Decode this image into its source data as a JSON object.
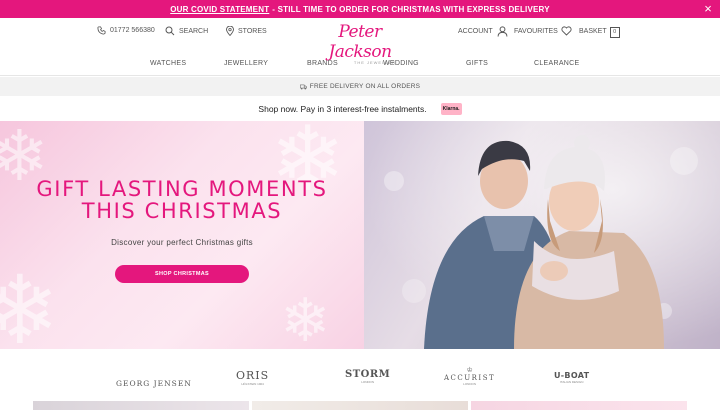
{
  "banner": {
    "link_text": "OUR COVID STATEMENT",
    "message": "- STILL TIME TO ORDER FOR CHRISTMAS WITH EXPRESS DELIVERY",
    "close_glyph": "×",
    "bg_color": "#e4177d"
  },
  "header": {
    "phone": "01772 566380",
    "search_label": "SEARCH",
    "stores_label": "STORES",
    "logo_text": "Peter Jackson",
    "logo_sub": "THE JEWELLER",
    "account_label": "ACCOUNT",
    "favourites_label": "FAVOURITES",
    "basket_label": "BASKET",
    "basket_count": "0",
    "icons": [
      "phone-icon",
      "search-icon",
      "map-pin-icon",
      "user-icon",
      "heart-icon",
      "basket-icon"
    ]
  },
  "nav": {
    "items": [
      "WATCHES",
      "JEWELLERY",
      "BRANDS",
      "WEDDING",
      "GIFTS",
      "CLEARANCE"
    ]
  },
  "delivery": {
    "text": "FREE DELIVERY ON ALL ORDERS",
    "icon": "truck-icon"
  },
  "klarna": {
    "text": "Shop now. Pay in 3 interest-free instalments.",
    "badge": "Klarna."
  },
  "hero": {
    "title_line1": "GIFT LASTING MOMENTS",
    "title_line2": "THIS CHRISTMAS",
    "subtitle": "Discover your perfect Christmas gifts",
    "button_label": "SHOP CHRISTMAS",
    "accent_color": "#e4177d"
  },
  "brands": {
    "items": [
      "GEORG JENSEN",
      "ORIS",
      "STORM",
      "ACCURIST",
      "U-BOAT"
    ],
    "sublabels": [
      "",
      "HÖLSTEIN 1904",
      "LONDON",
      "LONDON",
      "ITALIAN DESIGN"
    ]
  }
}
